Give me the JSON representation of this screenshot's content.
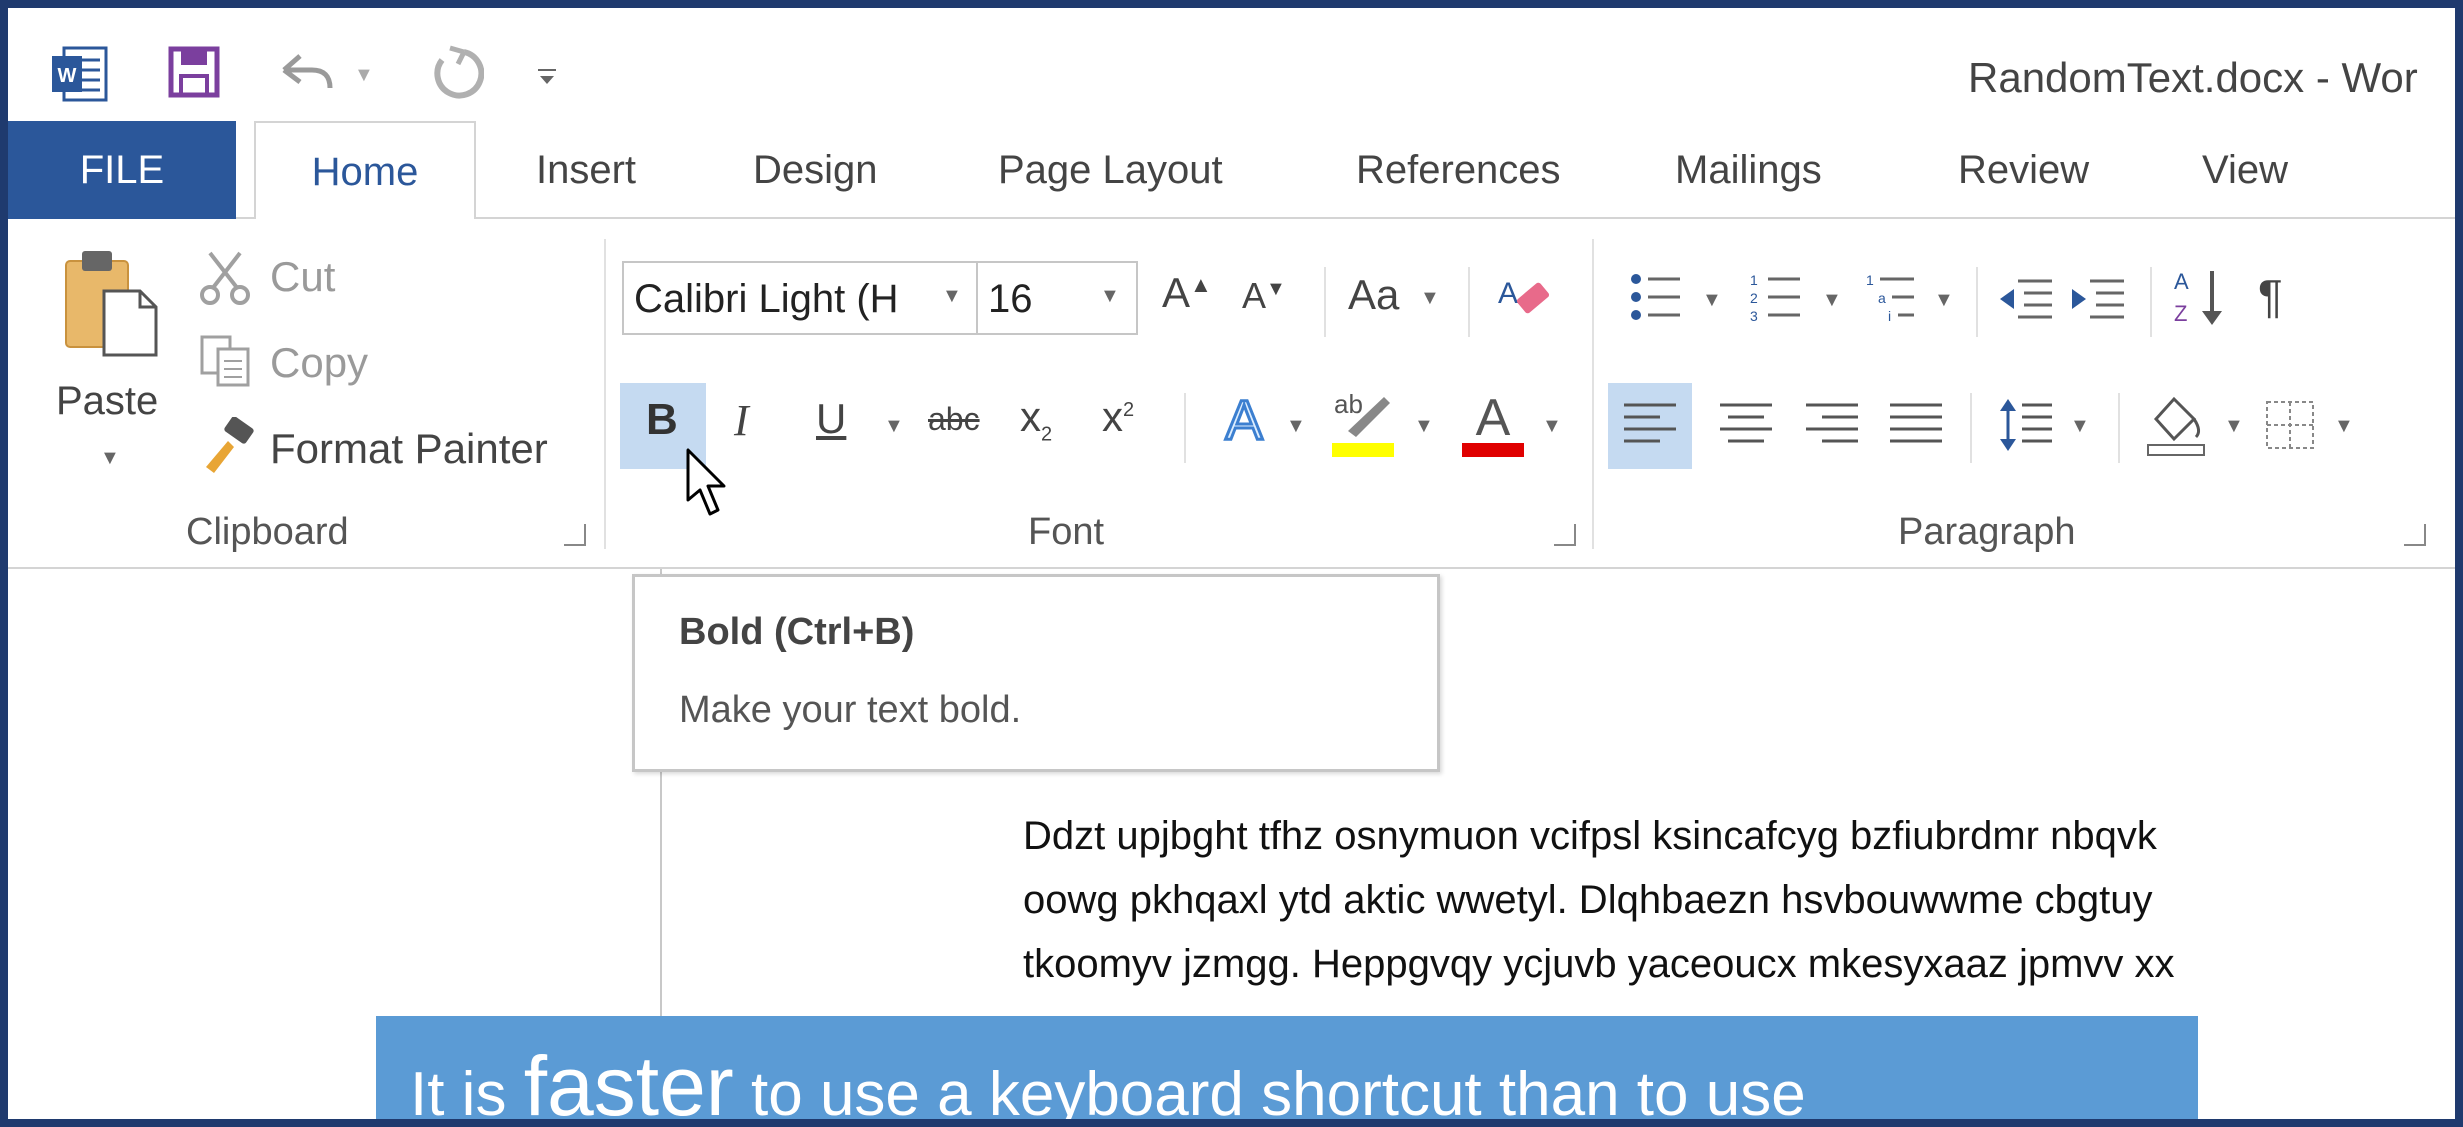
{
  "window": {
    "title": "RandomText.docx - Wor"
  },
  "tabs": [
    {
      "label": "FILE"
    },
    {
      "label": "Home"
    },
    {
      "label": "Insert"
    },
    {
      "label": "Design"
    },
    {
      "label": "Page Layout"
    },
    {
      "label": "References"
    },
    {
      "label": "Mailings"
    },
    {
      "label": "Review"
    },
    {
      "label": "View"
    }
  ],
  "clipboard": {
    "paste_label": "Paste",
    "cut_label": "Cut",
    "copy_label": "Copy",
    "format_painter_label": "Format Painter",
    "group_label": "Clipboard"
  },
  "font": {
    "font_name": "Calibri Light (H",
    "font_size": "16",
    "change_case_label": "Aa",
    "strikethrough_label": "abc",
    "group_label": "Font",
    "highlight_color": "#ffff00",
    "font_color": "#e00000"
  },
  "paragraph": {
    "group_label": "Paragraph",
    "pilcrow": "¶"
  },
  "tooltip": {
    "title": "Bold (Ctrl+B)",
    "description": "Make your text bold."
  },
  "document": {
    "lines": [
      "Ddzt upjbght tfhz osnymuon vcifpsl ksincafcyg bzfiubrdmr nbqvk",
      "oowg pkhqaxl ytd aktic wwetyl. Dlqhbaezn hsvbouwwme cbgtuy",
      "tkoomyv jzmgg. Heppgvqy ycjuvb yaceoucx mkesyxaaz jpmvv xx"
    ]
  },
  "caption": {
    "before": "It is ",
    "emphasis": "faster",
    "after": " to use a keyboard shortcut than to use"
  },
  "colors": {
    "accent": "#2b579a",
    "caption_bg": "#5b9bd5",
    "selected_bg": "#c5daf1"
  }
}
